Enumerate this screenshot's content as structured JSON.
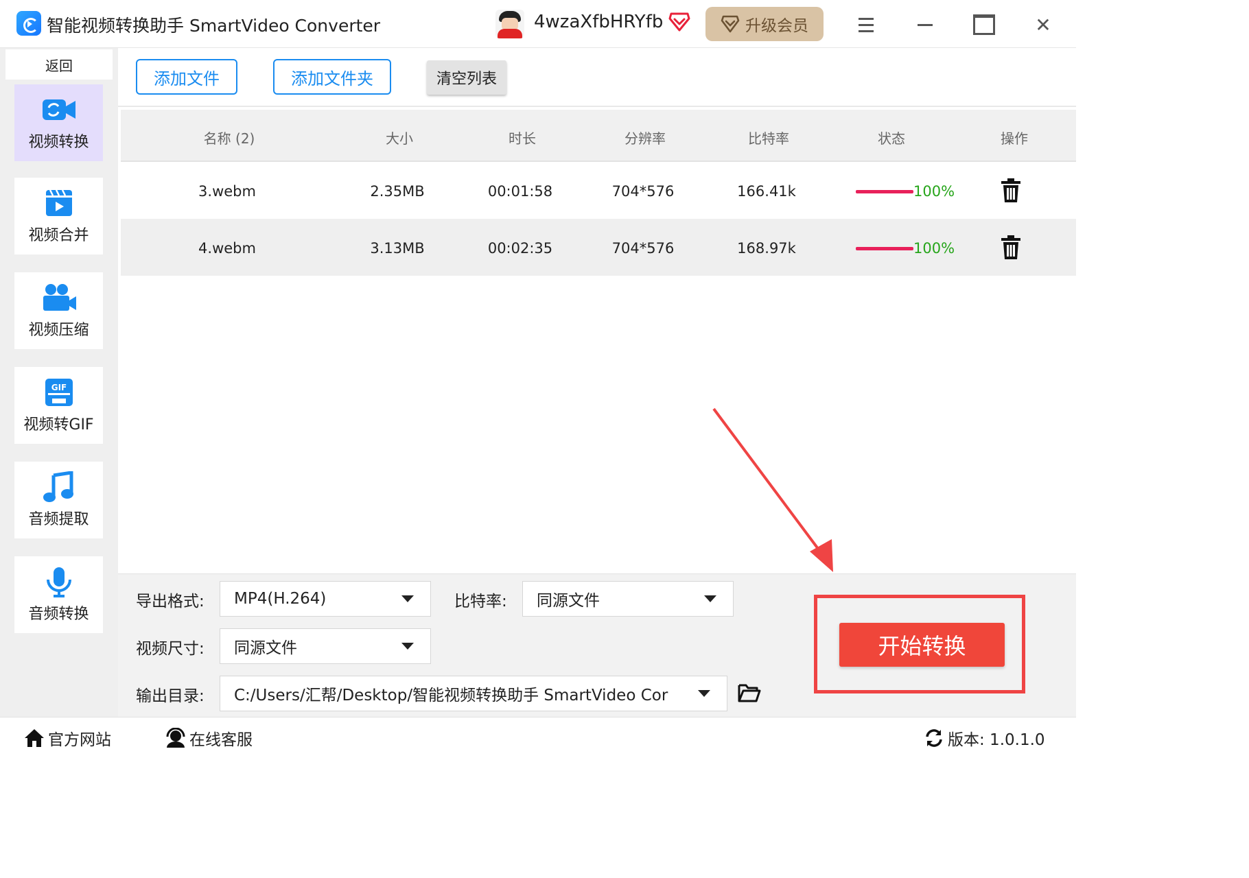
{
  "app": {
    "title": "智能视频转换助手 SmartVideo Converter"
  },
  "user": {
    "name": "4wzaXfbHRYfb",
    "upgrade_label": "升级会员"
  },
  "sidebar": {
    "back_label": "返回",
    "items": [
      {
        "label": "视频转换",
        "icon": "video-convert-icon",
        "active": true
      },
      {
        "label": "视频合并",
        "icon": "video-merge-icon",
        "active": false
      },
      {
        "label": "视频压缩",
        "icon": "video-compress-icon",
        "active": false
      },
      {
        "label": "视频转GIF",
        "icon": "gif-icon",
        "active": false
      },
      {
        "label": "音频提取",
        "icon": "music-note-icon",
        "active": false
      },
      {
        "label": "音频转换",
        "icon": "microphone-icon",
        "active": false
      }
    ]
  },
  "toolbar": {
    "add_file": "添加文件",
    "add_folder": "添加文件夹",
    "clear_list": "清空列表"
  },
  "table": {
    "headers": [
      "名称 (2)",
      "大小",
      "时长",
      "分辨率",
      "比特率",
      "状态",
      "操作"
    ],
    "rows": [
      {
        "name": "3.webm",
        "size": "2.35MB",
        "duration": "00:01:58",
        "resolution": "704*576",
        "bitrate": "166.41k",
        "progress": 1.0,
        "status": "100%"
      },
      {
        "name": "4.webm",
        "size": "3.13MB",
        "duration": "00:02:35",
        "resolution": "704*576",
        "bitrate": "168.97k",
        "progress": 1.0,
        "status": "100%"
      }
    ]
  },
  "settings": {
    "format_label": "导出格式:",
    "format_value": "MP4(H.264)",
    "bitrate_label": "比特率:",
    "bitrate_value": "同源文件",
    "size_label": "视频尺寸:",
    "size_value": "同源文件",
    "output_label": "输出目录:",
    "output_value": "C:/Users/汇帮/Desktop/智能视频转换助手 SmartVideo Cor"
  },
  "start_button": "开始转换",
  "footer": {
    "website": "官方网站",
    "support": "在线客服",
    "version": "版本: 1.0.1.0"
  },
  "colors": {
    "accent": "#1a8cf0",
    "start": "#f0463a",
    "progress": "#e8215a",
    "status_text": "#26a51a",
    "active_nav": "#e4ddfc"
  }
}
